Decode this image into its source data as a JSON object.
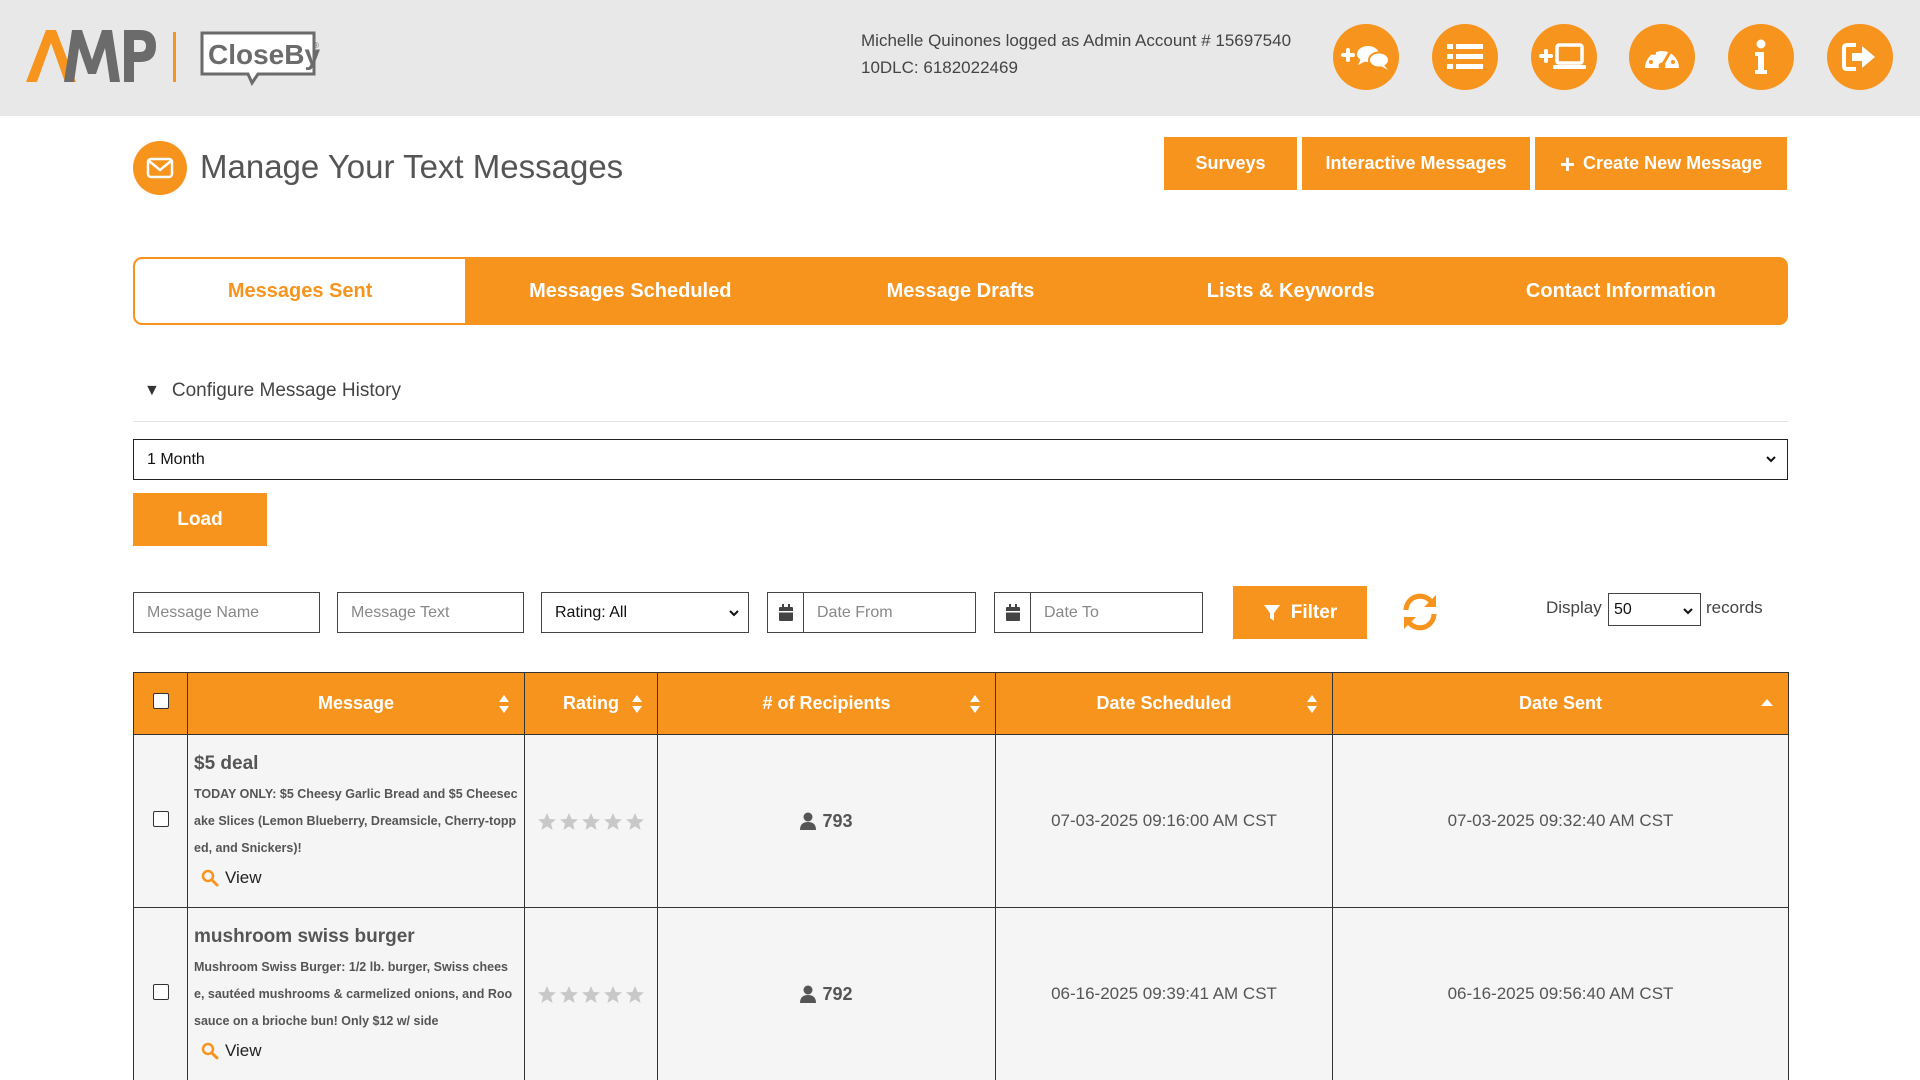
{
  "header": {
    "user_line": "Michelle Quinones logged as Admin Account # 15697540",
    "dlc_line": "10DLC: 6182022469",
    "buttons": [
      {
        "name": "add-chat-button",
        "icon": "plus-chat-icon"
      },
      {
        "name": "list-button",
        "icon": "list-icon"
      },
      {
        "name": "add-screen-button",
        "icon": "plus-laptop-icon"
      },
      {
        "name": "dashboard-button",
        "icon": "dashboard-icon"
      },
      {
        "name": "info-button",
        "icon": "info-icon"
      },
      {
        "name": "logout-button",
        "icon": "logout-icon"
      }
    ],
    "logo_amp": "AMP",
    "logo_closeby": "CloseBy"
  },
  "page": {
    "title": "Manage Your Text Messages",
    "actions": {
      "surveys": "Surveys",
      "interactive": "Interactive Messages",
      "create": "Create New Message"
    }
  },
  "tabs": [
    {
      "label": "Messages Sent",
      "active": true
    },
    {
      "label": "Messages Scheduled"
    },
    {
      "label": "Message Drafts"
    },
    {
      "label": "Lists & Keywords"
    },
    {
      "label": "Contact Information"
    }
  ],
  "history": {
    "toggle_label": "Configure Message History",
    "period": "1 Month",
    "load_label": "Load"
  },
  "filters": {
    "name_placeholder": "Message Name",
    "text_placeholder": "Message Text",
    "rating": "Rating: All",
    "date_from": "Date From",
    "date_to": "Date To",
    "filter_label": "Filter",
    "display_label": "Display",
    "display_count": "50",
    "records_label": "records"
  },
  "table": {
    "headers": {
      "message": "Message",
      "rating": "Rating",
      "recipients": "# of Recipients",
      "scheduled": "Date Scheduled",
      "sent": "Date Sent"
    },
    "rows": [
      {
        "name": "$5 deal",
        "text": "TODAY ONLY: $5 Cheesy Garlic Bread and $5 Cheesecake Slices (Lemon Blueberry, Dreamsicle, Cherry-topped, and Snickers)!",
        "view": "View",
        "recipients": "793",
        "scheduled": "07-03-2025 09:16:00 AM CST",
        "sent": "07-03-2025 09:32:40 AM CST"
      },
      {
        "name": "mushroom swiss burger",
        "text": "Mushroom Swiss Burger: 1/2 lb. burger, Swiss cheese, sautéed mushrooms & carmelized onions, and Roo sauce on a brioche bun! Only $12 w/ side",
        "view": "View",
        "recipients": "792",
        "scheduled": "06-16-2025 09:39:41 AM CST",
        "sent": "06-16-2025 09:56:40 AM CST"
      }
    ]
  },
  "colors": {
    "accent": "#f7941d",
    "header_bg": "#e8e8e8"
  }
}
